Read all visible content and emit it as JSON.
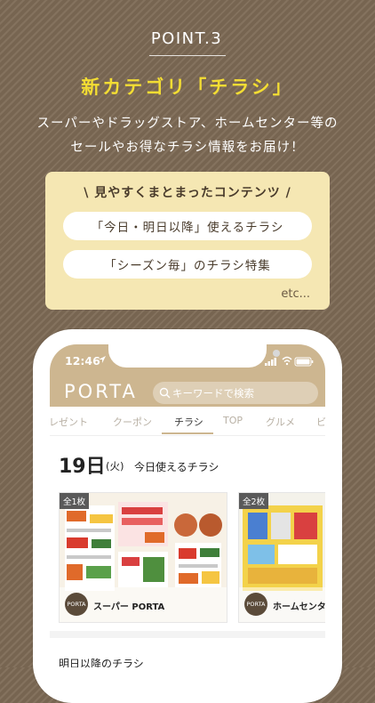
{
  "promo": {
    "point_label": "POINT.3",
    "headline": "新カテゴリ「チラシ」",
    "desc_line1": "スーパーやドラッグストア、ホームセンター等の",
    "desc_line2": "セールやお得なチラシ情報をお届け！"
  },
  "card": {
    "title": "\\ 見やすくまとまったコンテンツ /",
    "items": [
      "「今日・明日以降」使えるチラシ",
      "「シーズン毎」のチラシ特集"
    ],
    "etc": "etc..."
  },
  "phone": {
    "status": {
      "time": "12:46"
    },
    "app": {
      "logo": "PORTA",
      "search_placeholder": "キーワードで検索"
    },
    "tabs": [
      "プレゼント",
      "クーポン",
      "チラシ",
      "TOP",
      "グルメ",
      "ビ"
    ],
    "active_tab": "チラシ",
    "date": {
      "day": "19日",
      "weekday": "(火)"
    },
    "section_title": "今日使えるチラシ",
    "flyers": [
      {
        "badge": "全1枚",
        "avatar_text": "PORTA",
        "store": "スーパー PORTA"
      },
      {
        "badge": "全2枚",
        "avatar_text": "PORTA",
        "store": "ホームセンター"
      }
    ],
    "next_section_title": "明日以降のチラシ"
  },
  "colors": {
    "background": "#7d6a55",
    "headline": "#f3dd33",
    "card": "#f5e7b3",
    "app_bar": "#cdb690"
  }
}
